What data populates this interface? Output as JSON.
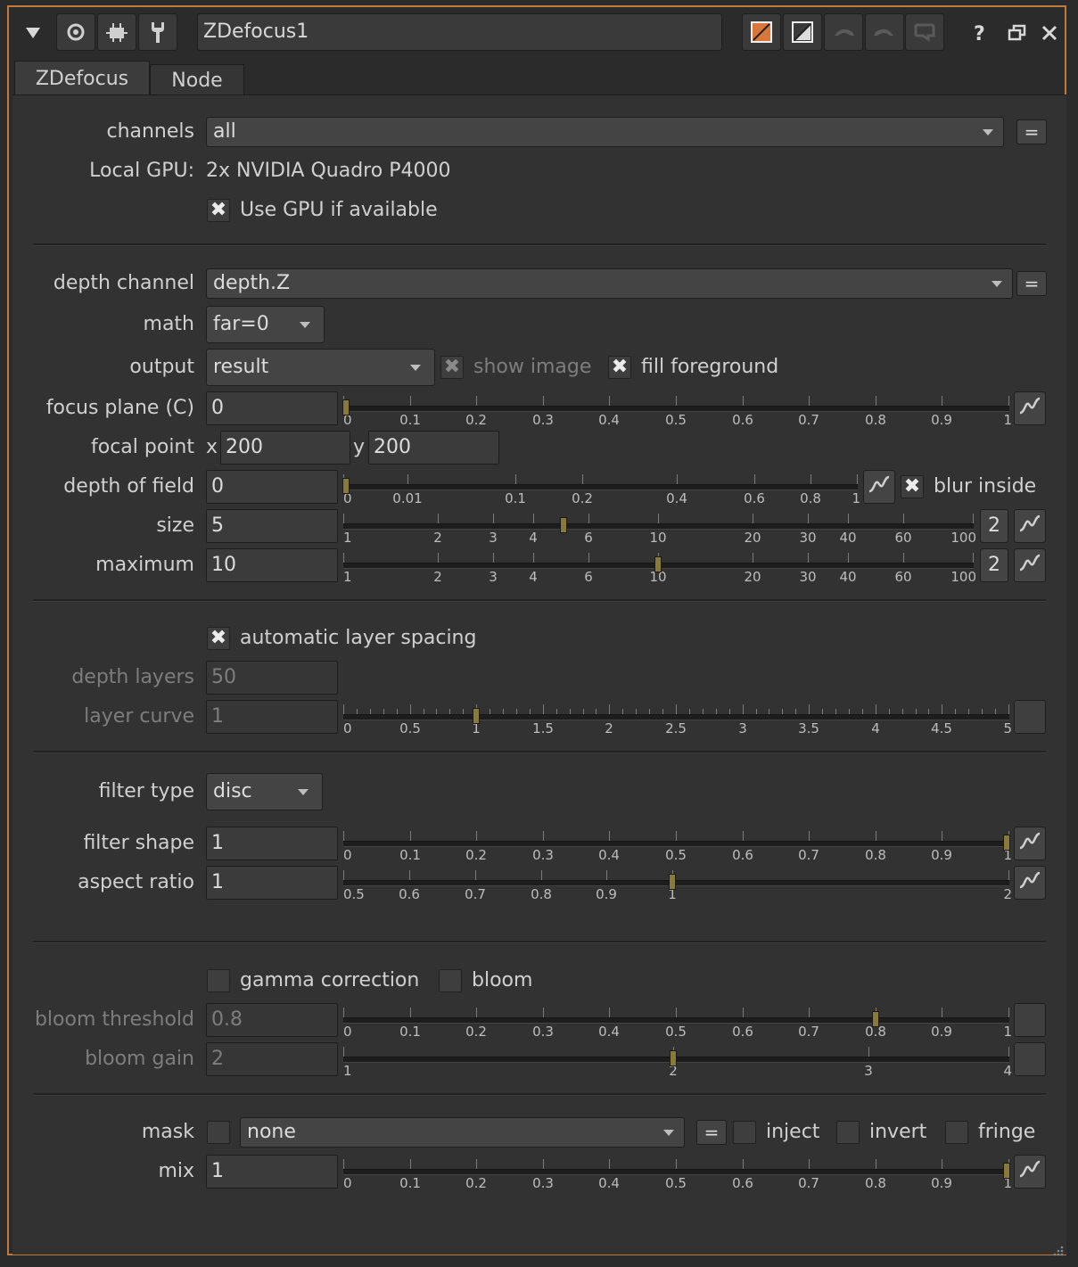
{
  "title_bar": {
    "node_name": "ZDefocus1"
  },
  "tabs": [
    {
      "label": "ZDefocus"
    },
    {
      "label": "Node"
    }
  ],
  "labels": {
    "channels": "channels",
    "local_gpu": "Local GPU:",
    "depth_channel": "depth channel",
    "math": "math",
    "output": "output",
    "focus_plane": "focus plane (C)",
    "focal_point": "focal point",
    "depth_of_field": "depth of field",
    "size": "size",
    "maximum": "maximum",
    "depth_layers": "depth layers",
    "layer_curve": "layer curve",
    "filter_type": "filter type",
    "filter_shape": "filter shape",
    "aspect_ratio": "aspect ratio",
    "bloom_threshold": "bloom threshold",
    "bloom_gain": "bloom gain",
    "mask": "mask",
    "mix": "mix"
  },
  "values": {
    "channels": "all",
    "local_gpu": "2x NVIDIA Quadro P4000",
    "depth_channel": "depth.Z",
    "math": "far=0",
    "output": "result",
    "focus_plane": "0",
    "focal_x_label": "x",
    "focal_x": "200",
    "focal_y_label": "y",
    "focal_y": "200",
    "depth_of_field": "0",
    "size": "5",
    "size_views": "2",
    "maximum": "10",
    "maximum_views": "2",
    "depth_layers": "50",
    "layer_curve": "1",
    "filter_type": "disc",
    "filter_shape": "1",
    "aspect_ratio": "1",
    "bloom_threshold": "0.8",
    "bloom_gain": "2",
    "mask": "none",
    "mix": "1"
  },
  "checkboxes": {
    "use_gpu": {
      "label": "Use GPU if available",
      "checked": true
    },
    "show_image": {
      "label": "show image",
      "checked": true
    },
    "fill_foreground": {
      "label": "fill foreground",
      "checked": true
    },
    "blur_inside": {
      "label": "blur inside",
      "checked": true
    },
    "auto_layer_spacing": {
      "label": "automatic layer spacing",
      "checked": true
    },
    "gamma_correction": {
      "label": "gamma correction",
      "checked": false
    },
    "bloom": {
      "label": "bloom",
      "checked": false
    },
    "mask_enable": {
      "label": "",
      "checked": false
    },
    "inject": {
      "label": "inject",
      "checked": false
    },
    "invert": {
      "label": "invert",
      "checked": false
    },
    "fringe": {
      "label": "fringe",
      "checked": false
    }
  },
  "sliders": {
    "focus_plane": {
      "ticks": [
        "0",
        "0.1",
        "0.2",
        "0.3",
        "0.4",
        "0.5",
        "0.6",
        "0.7",
        "0.8",
        "0.9",
        "1"
      ],
      "value": 0
    },
    "depth_of_field": {
      "ticks": [
        "0",
        "0.01",
        "0.1",
        "0.2",
        "0.4",
        "0.6",
        "0.8",
        "1"
      ],
      "value": 0
    },
    "size": {
      "ticks": [
        "1",
        "2",
        "3",
        "4",
        "6",
        "10",
        "20",
        "30",
        "40",
        "60",
        "100"
      ],
      "value": 5
    },
    "maximum": {
      "ticks": [
        "1",
        "2",
        "3",
        "4",
        "6",
        "10",
        "20",
        "30",
        "40",
        "60",
        "100"
      ],
      "value": 10
    },
    "layer_curve": {
      "ticks": [
        "0",
        "0.5",
        "1",
        "1.5",
        "2",
        "2.5",
        "3",
        "3.5",
        "4",
        "4.5",
        "5"
      ],
      "value": 1
    },
    "filter_shape": {
      "ticks": [
        "0",
        "0.1",
        "0.2",
        "0.3",
        "0.4",
        "0.5",
        "0.6",
        "0.7",
        "0.8",
        "0.9",
        "1"
      ],
      "value": 1
    },
    "aspect_ratio": {
      "ticks": [
        "0.5",
        "0.6",
        "0.7",
        "0.8",
        "0.9",
        "1",
        "2"
      ],
      "value": 1
    },
    "bloom_threshold": {
      "ticks": [
        "0",
        "0.1",
        "0.2",
        "0.3",
        "0.4",
        "0.5",
        "0.6",
        "0.7",
        "0.8",
        "0.9",
        "1"
      ],
      "value": 0.8
    },
    "bloom_gain": {
      "ticks": [
        "1",
        "2",
        "3",
        "4"
      ],
      "value": 2
    },
    "mix": {
      "ticks": [
        "0",
        "0.1",
        "0.2",
        "0.3",
        "0.4",
        "0.5",
        "0.6",
        "0.7",
        "0.8",
        "0.9",
        "1"
      ],
      "value": 1
    }
  },
  "icons": {
    "collapse": "triangle-down-icon",
    "viewer": "target-icon",
    "node_graph": "node-graph-icon",
    "settings": "wrench-icon",
    "color_swatch": "color-swatch-icon",
    "gl_color": "gl-color-icon",
    "undo": "undo-icon",
    "redo": "redo-icon",
    "revert": "revert-icon",
    "help": "help-icon",
    "float": "float-window-icon",
    "close": "close-icon",
    "animation": "curve-icon"
  },
  "colors": {
    "accent": "#c07a3c",
    "handle": "#8a7a3a",
    "swatch": "#d9773a"
  }
}
